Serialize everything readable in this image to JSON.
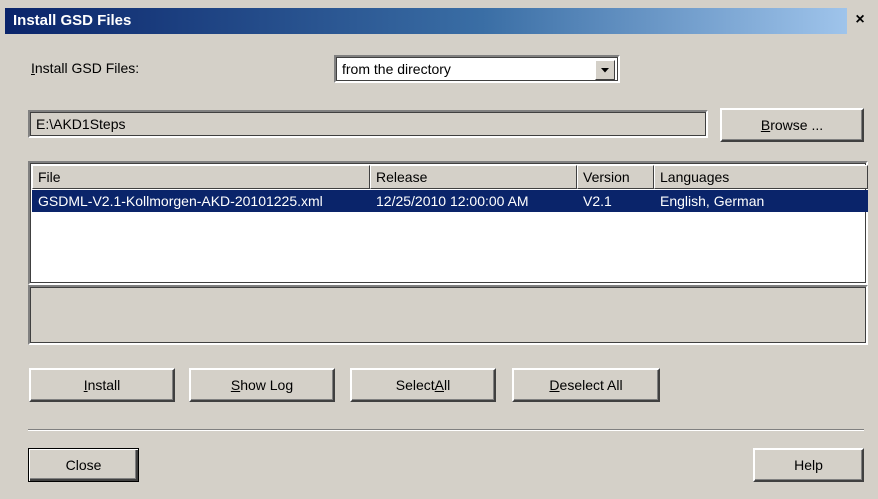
{
  "window": {
    "title": "Install GSD Files",
    "close_glyph": "×"
  },
  "install_source": {
    "label": "Install GSD Files:",
    "selected_option": "from the directory"
  },
  "directory": {
    "path": "E:\\AKD1Steps",
    "browse_label": "Browse ..."
  },
  "file_list": {
    "columns": [
      "File",
      "Release",
      "Version",
      "Languages"
    ],
    "rows": [
      {
        "file": "GSDML-V2.1-Kollmorgen-AKD-20101225.xml",
        "release": "12/25/2010 12:00:00 AM",
        "version": "V2.1",
        "languages": "English, German",
        "selected": true
      }
    ]
  },
  "actions": {
    "install": "Install",
    "show_log": "Show Log",
    "select_all": "Select All",
    "deselect_all": "Deselect All"
  },
  "footer": {
    "close": "Close",
    "help": "Help"
  },
  "colors": {
    "title_bar_start": "#0a246a",
    "title_bar_end": "#a6caf0",
    "dialog_face": "#d4d0c8",
    "selection": "#0a246a"
  }
}
